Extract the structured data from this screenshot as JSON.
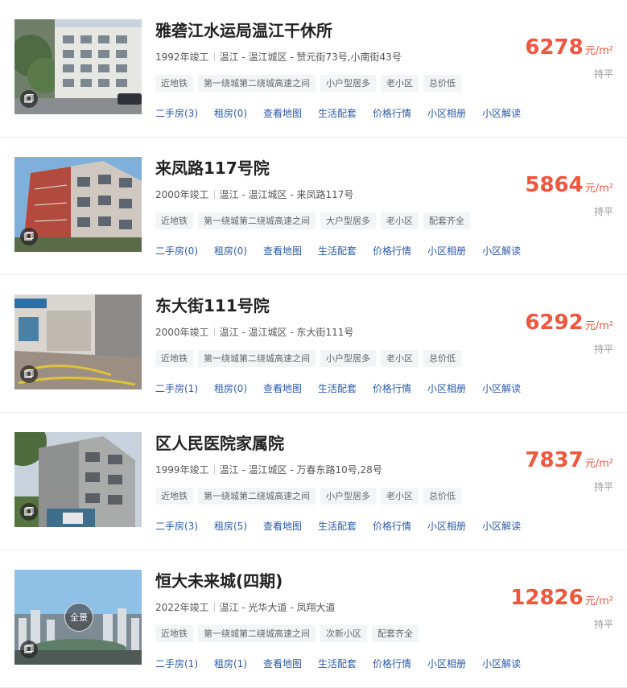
{
  "items": [
    {
      "title": "雅砻江水运局温江干休所",
      "year": "1992年竣工",
      "location": "温江 - 温江城区 - 赞元街73号,小南街43号",
      "tags": [
        "近地铁",
        "第一绕城第二绕城高速之间",
        "小户型居多",
        "老小区",
        "总价低"
      ],
      "links": [
        "二手房(3)",
        "租房(0)",
        "查看地图",
        "生活配套",
        "价格行情",
        "小区相册",
        "小区解读"
      ],
      "price": "6278",
      "unit": "元/m²",
      "trend": "持平",
      "photo": "building-white"
    },
    {
      "title": "来凤路117号院",
      "year": "2000年竣工",
      "location": "温江 - 温江城区 - 来凤路117号",
      "tags": [
        "近地铁",
        "第一绕城第二绕城高速之间",
        "大户型居多",
        "老小区",
        "配套齐全"
      ],
      "links": [
        "二手房(0)",
        "租房(0)",
        "查看地图",
        "生活配套",
        "价格行情",
        "小区相册",
        "小区解读"
      ],
      "price": "5864",
      "unit": "元/m²",
      "trend": "持平",
      "photo": "building-red"
    },
    {
      "title": "东大街111号院",
      "year": "2000年竣工",
      "location": "温江 - 温江城区 - 东大街111号",
      "tags": [
        "近地铁",
        "第一绕城第二绕城高速之间",
        "小户型居多",
        "老小区",
        "总价低"
      ],
      "links": [
        "二手房(1)",
        "租房(0)",
        "查看地图",
        "生活配套",
        "价格行情",
        "小区相册",
        "小区解读"
      ],
      "price": "6292",
      "unit": "元/m²",
      "trend": "持平",
      "photo": "street"
    },
    {
      "title": "区人民医院家属院",
      "year": "1999年竣工",
      "location": "温江 - 温江城区 - 万春东路10号,28号",
      "tags": [
        "近地铁",
        "第一绕城第二绕城高速之间",
        "小户型居多",
        "老小区",
        "总价低"
      ],
      "links": [
        "二手房(3)",
        "租房(5)",
        "查看地图",
        "生活配套",
        "价格行情",
        "小区相册",
        "小区解读"
      ],
      "price": "7837",
      "unit": "元/m²",
      "trend": "持平",
      "photo": "building-gray"
    },
    {
      "title": "恒大未来城(四期)",
      "year": "2022年竣工",
      "location": "温江 - 光华大道 - 凤翔大道",
      "tags": [
        "近地铁",
        "第一绕城第二绕城高速之间",
        "次新小区",
        "配套齐全"
      ],
      "links": [
        "二手房(1)",
        "租房(1)",
        "查看地图",
        "生活配套",
        "价格行情",
        "小区相册",
        "小区解读"
      ],
      "price": "12826",
      "unit": "元/m²",
      "trend": "持平",
      "photo": "panorama",
      "pano_label": "全景"
    }
  ]
}
